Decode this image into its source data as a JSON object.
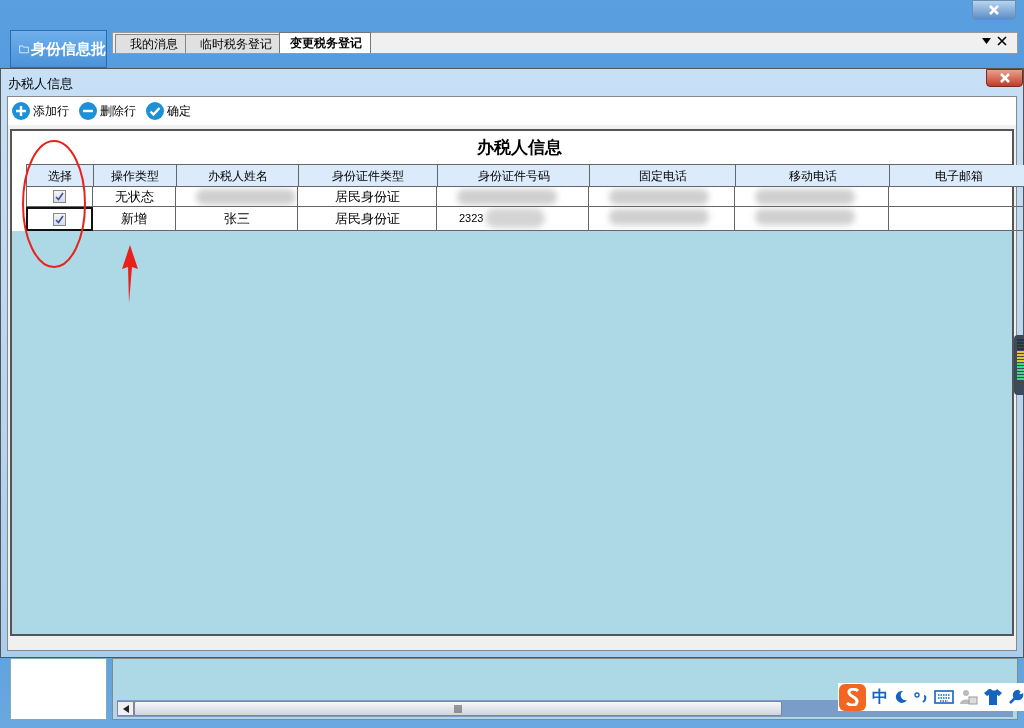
{
  "main_window": {
    "side_panel_title": "身份信息批",
    "tabs": [
      {
        "label": "我的消息",
        "selected": false
      },
      {
        "label": "临时税务登记",
        "selected": false
      },
      {
        "label": "变更税务登记",
        "selected": true
      }
    ]
  },
  "dialog": {
    "title": "办税人信息",
    "toolbar": [
      {
        "kind": "add",
        "label": "添加行"
      },
      {
        "kind": "remove",
        "label": "删除行"
      },
      {
        "kind": "confirm",
        "label": "确定"
      }
    ],
    "grid": {
      "title": "办税人信息",
      "columns": [
        "选择",
        "操作类型",
        "办税人姓名",
        "身份证件类型",
        "身份证件号码",
        "固定电话",
        "移动电话",
        "电子邮箱"
      ],
      "rows": [
        {
          "selected": false,
          "cells": [
            {
              "checked": true
            },
            {
              "text": "无状态",
              "blurred": false
            },
            {
              "blurred": true
            },
            {
              "text": "居民身份证",
              "blurred": false
            },
            {
              "blurred": true
            },
            {
              "blurred": true
            },
            {
              "blurred": true
            },
            {
              "blurred": false
            }
          ]
        },
        {
          "selected": true,
          "cells": [
            {
              "checked": true
            },
            {
              "text": "新增",
              "blurred": false
            },
            {
              "text": "张三",
              "blurred": false
            },
            {
              "text": "居民身份证",
              "blurred": false
            },
            {
              "text": "2323",
              "blurred": true
            },
            {
              "blurred": true
            },
            {
              "blurred": true
            },
            {
              "blurred": false
            }
          ]
        }
      ]
    }
  },
  "ime_bar": {
    "mode": "中"
  }
}
